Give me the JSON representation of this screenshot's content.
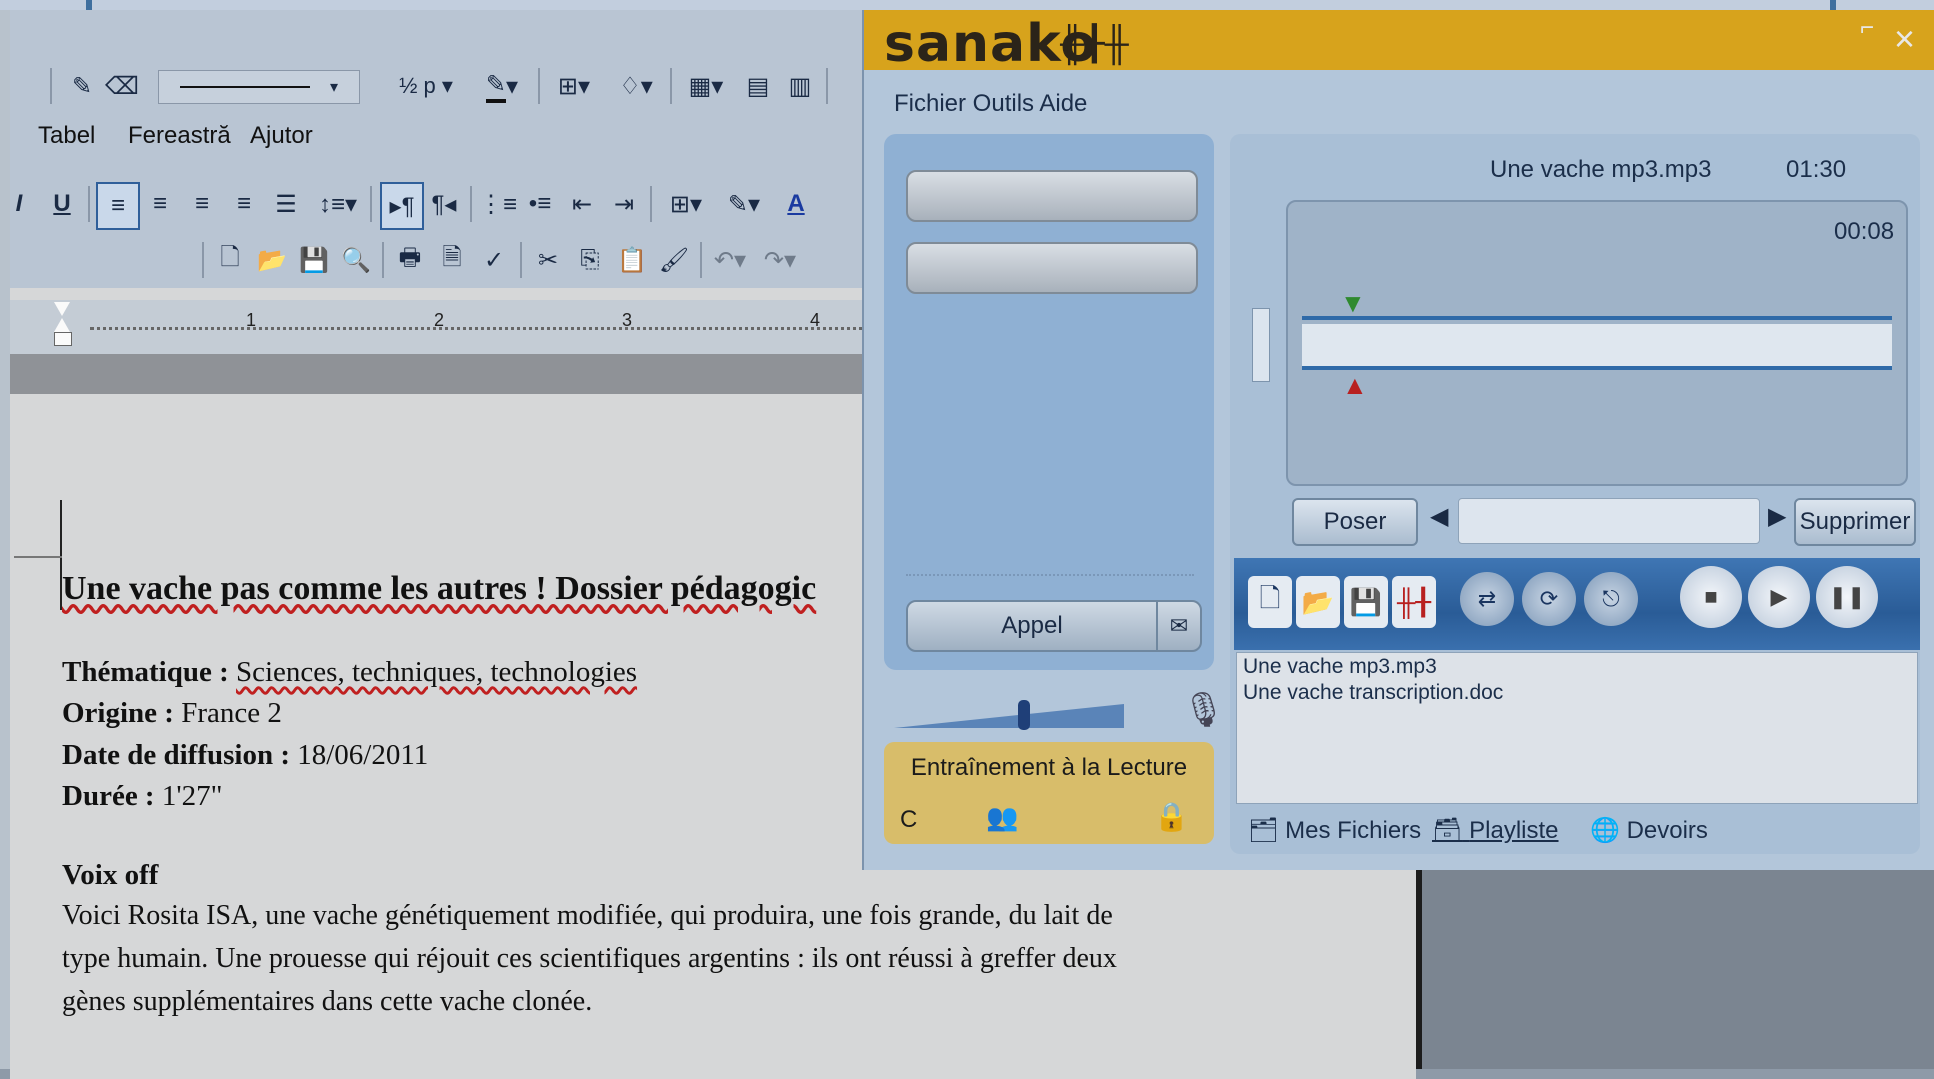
{
  "word": {
    "menu": [
      "Tabel",
      "Fereastră",
      "Ajutor"
    ],
    "line_weight": "½ p",
    "ruler_numbers": [
      "1",
      "2",
      "3",
      "4"
    ],
    "document": {
      "title": "Une vache pas comme les autres ! Dossier pédagogic",
      "thematique_label": "Thématique :",
      "thematique_value": "Sciences, techniques, technologies",
      "origine_label": "Origine :",
      "origine_value": "France 2",
      "date_label": "Date de diffusion :",
      "date_value": "18/06/2011",
      "duree_label": "Durée :",
      "duree_value": "1'27\"",
      "voix_off": "Voix off",
      "paragraph_lines": [
        "Voici Rosita ISA, une vache génétiquement modifiée, qui produira, une fois grande, du lait de",
        "type humain. Une prouesse qui réjouit ces scientifiques argentins : ils ont réussi à greffer deux",
        "gènes supplémentaires dans cette vache clonée."
      ]
    }
  },
  "sanako": {
    "logo": "sanako",
    "menu": "Fichier Outils Aide",
    "appel_label": "Appel",
    "mode_label": "Entraînement à la Lecture",
    "mode_letter": "C",
    "track_name": "Une vache mp3.mp3",
    "track_length": "01:30",
    "track_position": "00:08",
    "poser_label": "Poser",
    "supprimer_label": "Supprimer",
    "files": [
      "Une vache mp3.mp3",
      "Une vache transcription.doc"
    ],
    "tabs": [
      "Mes Fichiers",
      "Playliste",
      "Devoirs"
    ],
    "colors": {
      "title_bar": "#d7a31c",
      "player_bar": "#2a5c97",
      "panel": "#b3c6da"
    }
  }
}
